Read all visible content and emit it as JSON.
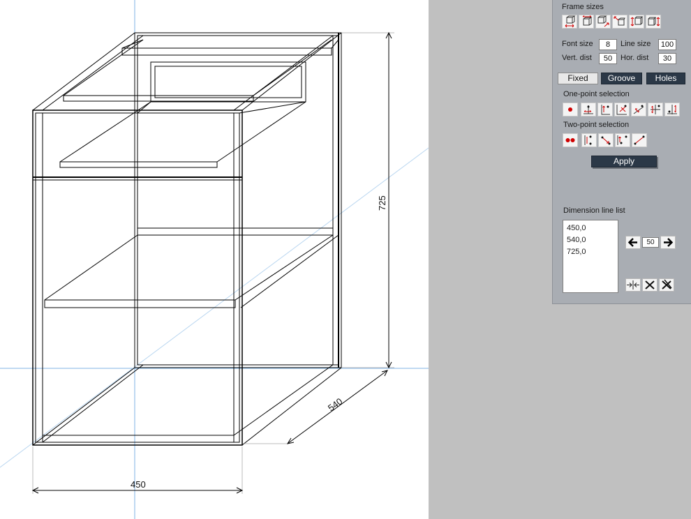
{
  "viewport": {
    "dimensions": [
      {
        "value": "450",
        "axis": "width"
      },
      {
        "value": "540",
        "axis": "depth"
      },
      {
        "value": "725",
        "axis": "height"
      }
    ]
  },
  "panel": {
    "frame_sizes_label": "Frame sizes",
    "frame_size_icons": [
      "box-width-icon",
      "box-depth-icon",
      "box-diagonal-icon",
      "box-corner-icon",
      "box-height-icon",
      "box-height-alt-icon"
    ],
    "fields": {
      "font_size": {
        "label": "Font size",
        "value": "8"
      },
      "line_size": {
        "label": "Line size",
        "value": "100"
      },
      "vert_dist": {
        "label": "Vert. dist",
        "value": "50"
      },
      "hor_dist": {
        "label": "Hor. dist",
        "value": "30"
      }
    },
    "tabs": [
      {
        "label": "Fixed",
        "active": true
      },
      {
        "label": "Groove",
        "active": false
      },
      {
        "label": "Holes",
        "active": false
      }
    ],
    "one_point_label": "One-point selection",
    "one_point_icons": [
      "single-point-icon",
      "point-horizontal-dim-icon",
      "point-vertical-dim-icon",
      "point-diagonal-dim-icon",
      "point-diagonal-alt-icon",
      "point-vertical-left-icon",
      "point-vertical-right-icon"
    ],
    "two_point_label": "Two-point selection",
    "two_point_icons": [
      "two-points-icon",
      "two-point-vertical-icon",
      "two-point-diagonal-icon",
      "two-point-corner-icon",
      "two-point-line-icon"
    ],
    "apply_label": "Apply",
    "dimension_list_label": "Dimension line list",
    "dimension_list": [
      "450,0",
      "540,0",
      "725,0"
    ],
    "step_value": "50",
    "accent_red": "#d00000",
    "dark_button": "#2b3847"
  }
}
